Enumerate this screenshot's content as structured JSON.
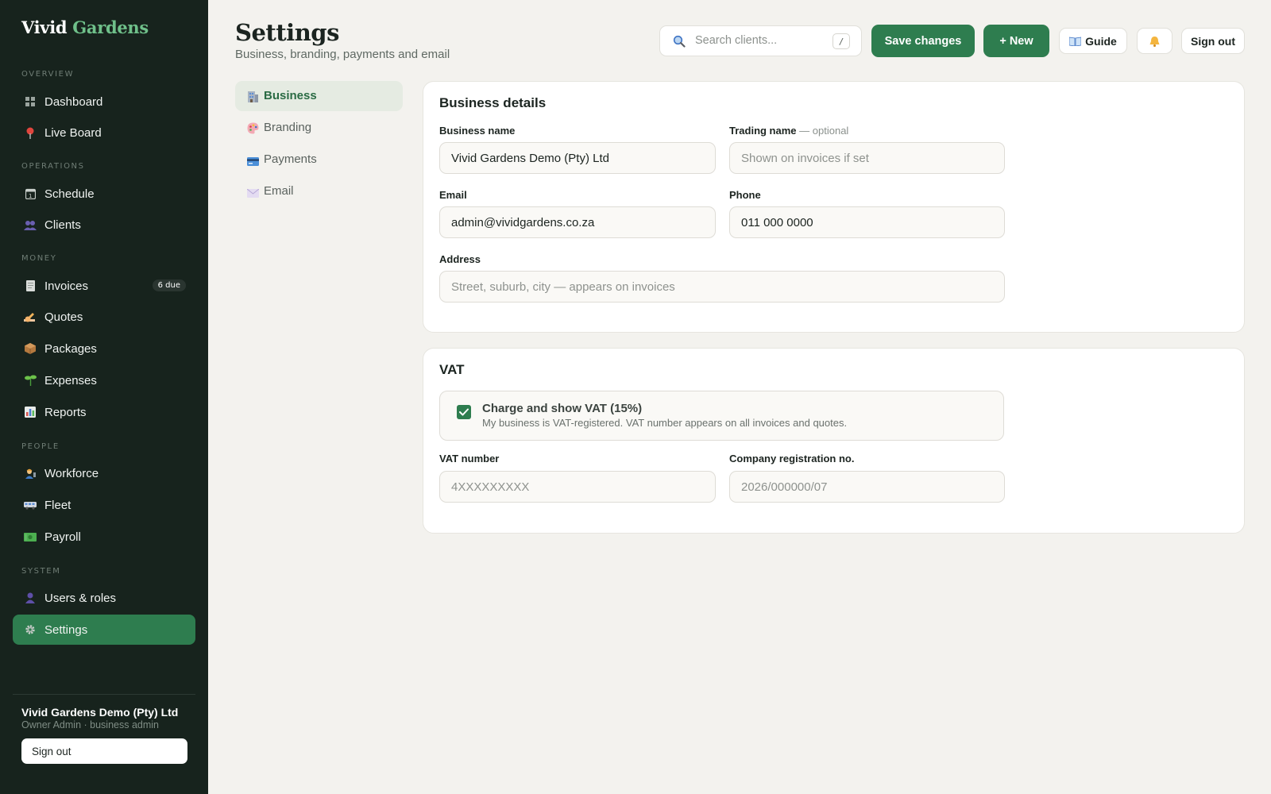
{
  "brand": {
    "word1": "Vivid",
    "word2": "Gardens"
  },
  "sidebar": {
    "sections": [
      "OVERVIEW",
      "OPERATIONS",
      "MONEY",
      "PEOPLE",
      "SYSTEM"
    ],
    "items": [
      {
        "label": "Dashboard",
        "icon": "grid-icon"
      },
      {
        "label": "Live Board",
        "icon": "pin-icon"
      },
      {
        "label": "Schedule",
        "icon": "calendar-icon"
      },
      {
        "label": "Clients",
        "icon": "people-icon"
      },
      {
        "label": "Invoices",
        "icon": "receipt-icon",
        "badge": "6 due"
      },
      {
        "label": "Quotes",
        "icon": "writing-hand-icon"
      },
      {
        "label": "Packages",
        "icon": "package-icon"
      },
      {
        "label": "Expenses",
        "icon": "seedling-icon"
      },
      {
        "label": "Reports",
        "icon": "bar-chart-icon"
      },
      {
        "label": "Workforce",
        "icon": "worker-icon"
      },
      {
        "label": "Fleet",
        "icon": "truck-icon"
      },
      {
        "label": "Payroll",
        "icon": "cash-icon"
      },
      {
        "label": "Users & roles",
        "icon": "user-icon"
      },
      {
        "label": "Settings",
        "icon": "gear-icon",
        "active": true
      }
    ],
    "org_name": "Vivid Gardens Demo (Pty) Ltd",
    "org_role": "Owner Admin · business admin",
    "signout_label": "Sign out"
  },
  "header": {
    "title": "Settings",
    "subtitle": "Business, branding, payments and email",
    "search_placeholder": "Search clients...",
    "search_shortcut": "/",
    "save_label": "Save changes",
    "new_label": "+ New",
    "guide_label": "Guide",
    "signout_label": "Sign out"
  },
  "subnav": [
    {
      "label": "Business",
      "icon": "building-icon",
      "active": true
    },
    {
      "label": "Branding",
      "icon": "palette-icon"
    },
    {
      "label": "Payments",
      "icon": "credit-card-icon"
    },
    {
      "label": "Email",
      "icon": "envelope-icon"
    }
  ],
  "business": {
    "title": "Business details",
    "business_name_label": "Business name",
    "business_name_value": "Vivid Gardens Demo (Pty) Ltd",
    "trading_name_label": "Trading name",
    "trading_name_optional": "— optional",
    "trading_name_placeholder": "Shown on invoices if set",
    "email_label": "Email",
    "email_value": "admin@vividgardens.co.za",
    "phone_label": "Phone",
    "phone_value": "011 000 0000",
    "address_label": "Address",
    "address_placeholder": "Street, suburb, city — appears on invoices"
  },
  "vat": {
    "title": "VAT",
    "charge_label": "Charge and show VAT (15%)",
    "charge_desc": "My business is VAT-registered. VAT number appears on all invoices and quotes.",
    "charge_checked": true,
    "vat_number_label": "VAT number",
    "vat_number_placeholder": "4XXXXXXXXX",
    "company_reg_label": "Company registration no.",
    "company_reg_placeholder": "2026/000000/07"
  },
  "colors": {
    "sidebar_bg": "#17231d",
    "accent_green": "#2e7d4f",
    "brand_green": "#6fc08a",
    "page_bg": "#f3f2ee"
  }
}
